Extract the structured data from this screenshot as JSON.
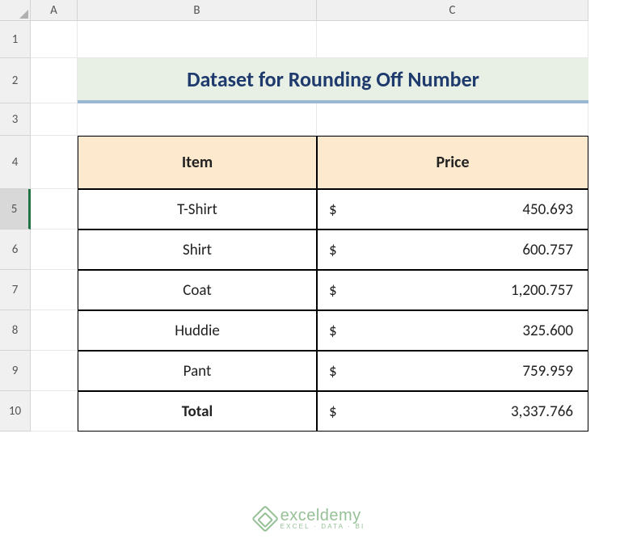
{
  "columns": [
    "A",
    "B",
    "C"
  ],
  "rows": [
    "1",
    "2",
    "3",
    "4",
    "5",
    "6",
    "7",
    "8",
    "9",
    "10"
  ],
  "selected_row": "5",
  "title": "Dataset for Rounding Off Number",
  "headers": {
    "item": "Item",
    "price": "Price"
  },
  "currency": "$",
  "data_rows": [
    {
      "item": "T-Shirt",
      "price": "450.693"
    },
    {
      "item": "Shirt",
      "price": "600.757"
    },
    {
      "item": "Coat",
      "price": "1,200.757"
    },
    {
      "item": "Huddie",
      "price": "325.600"
    },
    {
      "item": "Pant",
      "price": "759.959"
    }
  ],
  "total": {
    "label": "Total",
    "price": "3,337.766"
  },
  "watermark": {
    "brand": "exceldemy",
    "sub": "EXCEL · DATA · BI"
  }
}
